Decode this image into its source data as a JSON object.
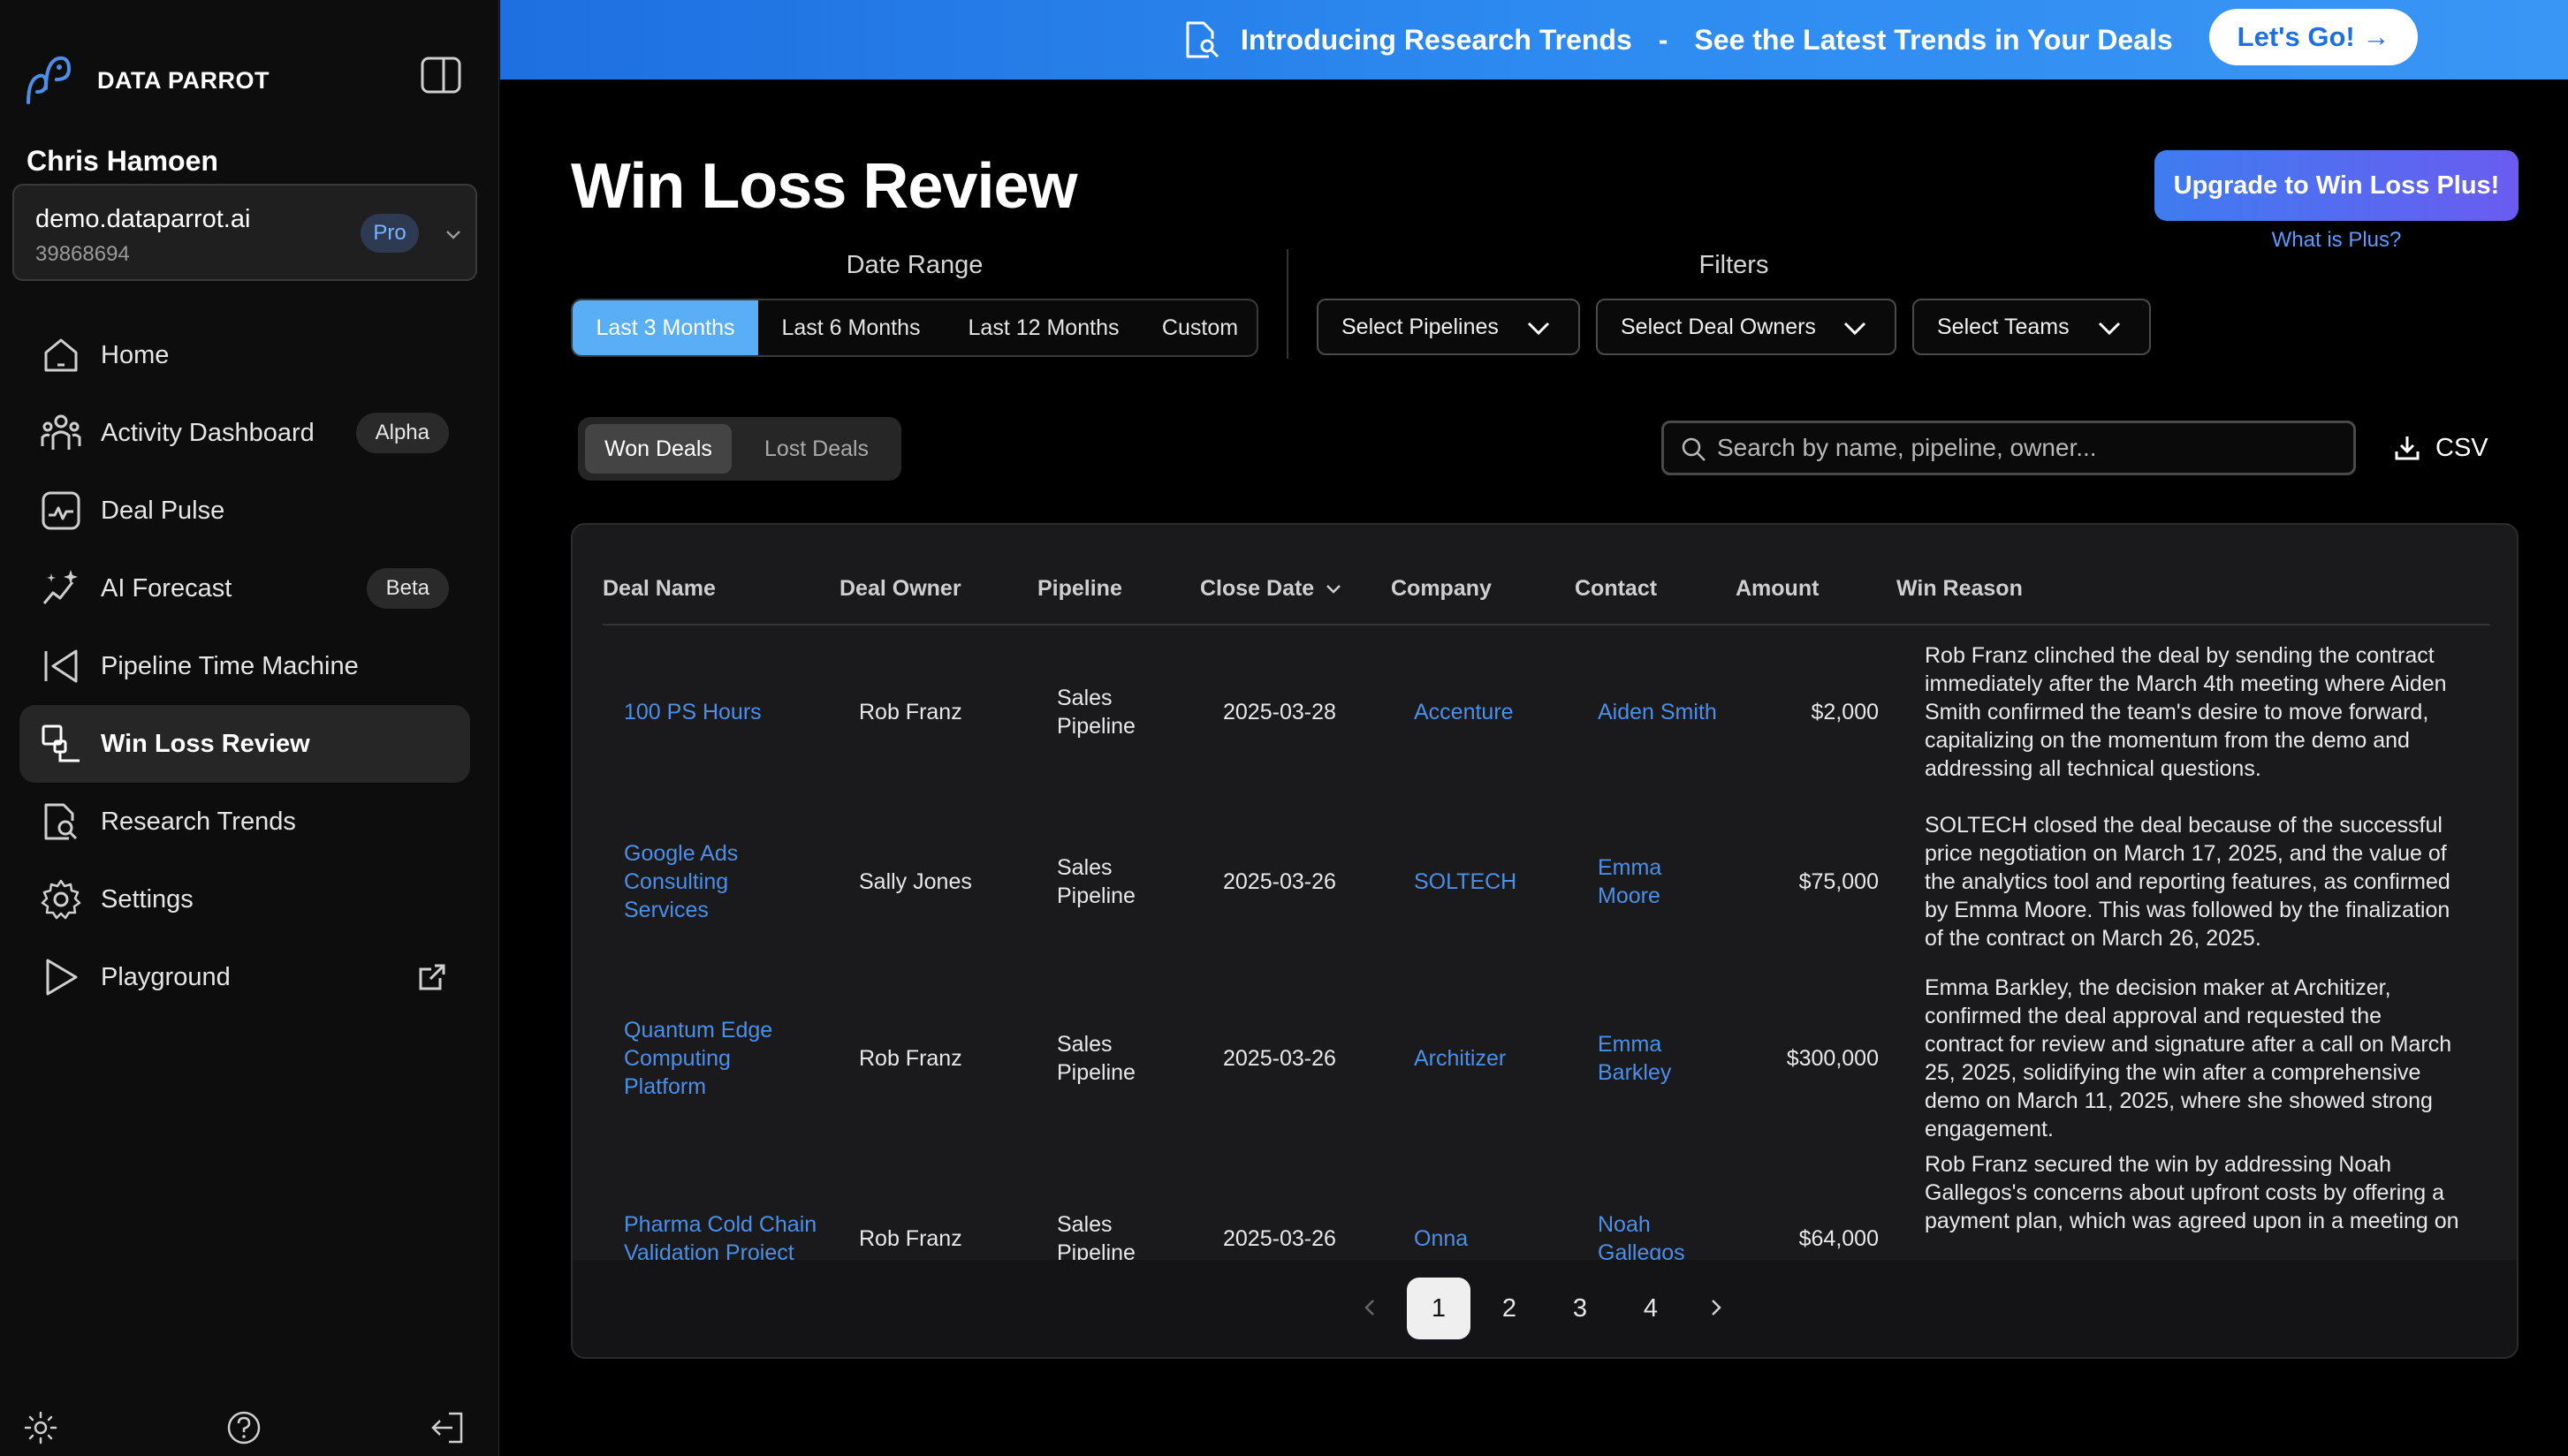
{
  "brand": {
    "name": "DATA PARROT"
  },
  "user": {
    "name": "Chris Hamoen"
  },
  "workspace": {
    "domain": "demo.dataparrot.ai",
    "id": "39868694",
    "plan": "Pro"
  },
  "nav": [
    {
      "label": "Home",
      "icon": "home-icon"
    },
    {
      "label": "Activity Dashboard",
      "icon": "people-icon",
      "badge": "Alpha"
    },
    {
      "label": "Deal Pulse",
      "icon": "pulse-icon"
    },
    {
      "label": "AI Forecast",
      "icon": "sparkle-icon",
      "badge": "Beta"
    },
    {
      "label": "Pipeline Time Machine",
      "icon": "rewind-icon"
    },
    {
      "label": "Win Loss Review",
      "icon": "win-loss-icon",
      "active": true
    },
    {
      "label": "Research Trends",
      "icon": "document-search-icon"
    },
    {
      "label": "Settings",
      "icon": "gear-icon"
    },
    {
      "label": "Playground",
      "icon": "play-icon"
    }
  ],
  "banner": {
    "title": "Introducing Research Trends",
    "separator": "-",
    "subtitle": "See the Latest Trends in Your Deals",
    "cta": "Let's Go! →"
  },
  "page": {
    "title": "Win Loss Review",
    "upgrade": "Upgrade to Win Loss Plus!",
    "what_plus": "What is Plus?"
  },
  "date_range": {
    "label": "Date Range",
    "options": [
      "Last 3 Months",
      "Last 6 Months",
      "Last 12 Months",
      "Custom"
    ],
    "selected": "Last 3 Months"
  },
  "filters": {
    "label": "Filters",
    "pipelines": "Select Pipelines",
    "owners": "Select Deal Owners",
    "teams": "Select Teams"
  },
  "deal_tabs": {
    "won": "Won Deals",
    "lost": "Lost Deals",
    "selected": "Won Deals"
  },
  "search": {
    "placeholder": "Search by name, pipeline, owner...",
    "value": ""
  },
  "csv_label": "CSV",
  "table": {
    "columns": [
      "Deal Name",
      "Deal Owner",
      "Pipeline",
      "Close Date",
      "Company",
      "Contact",
      "Amount",
      "Win Reason"
    ],
    "rows": [
      {
        "deal": [
          "100 PS Hours"
        ],
        "owner": "Rob Franz",
        "pipeline": [
          "Sales",
          "Pipeline"
        ],
        "date": "2025-03-28",
        "company": "Accenture",
        "contact": [
          "Aiden Smith"
        ],
        "amount": "$2,000",
        "reason": [
          "Rob Franz clinched the deal by sending the contract",
          "immediately after the March 4th meeting where Aiden",
          "Smith confirmed the team's desire to move forward,",
          "capitalizing on the momentum from the demo and",
          "addressing all technical questions."
        ]
      },
      {
        "deal": [
          "Google Ads",
          "Consulting",
          "Services"
        ],
        "owner": "Sally Jones",
        "pipeline": [
          "Sales",
          "Pipeline"
        ],
        "date": "2025-03-26",
        "company": "SOLTECH",
        "contact": [
          "Emma",
          "Moore"
        ],
        "amount": "$75,000",
        "reason": [
          "SOLTECH closed the deal because of the successful",
          "price negotiation on March 17, 2025, and the value of",
          "the analytics tool and reporting features, as confirmed",
          "by Emma Moore. This was followed by the finalization",
          "of the contract on March 26, 2025."
        ]
      },
      {
        "deal": [
          "Quantum Edge",
          "Computing",
          "Platform"
        ],
        "owner": "Rob Franz",
        "pipeline": [
          "Sales",
          "Pipeline"
        ],
        "date": "2025-03-26",
        "company": "Architizer",
        "contact": [
          "Emma",
          "Barkley"
        ],
        "amount": "$300,000",
        "reason": [
          "Emma Barkley, the decision maker at Architizer,",
          "confirmed the deal approval and requested the",
          "contract for review and signature after a call on March",
          "25, 2025, solidifying the win after a comprehensive",
          "demo on March 11, 2025, where she showed strong",
          "engagement."
        ]
      },
      {
        "deal": [
          "Pharma Cold Chain",
          "Validation Project"
        ],
        "owner": "Rob Franz",
        "pipeline": [
          "Sales",
          "Pipeline"
        ],
        "date": "2025-03-26",
        "company": "Onna",
        "contact": [
          "Noah",
          "Gallegos"
        ],
        "amount": "$64,000",
        "reason": [
          "Rob Franz secured the win by addressing Noah",
          "Gallegos's concerns about upfront costs by offering a",
          "payment plan, which was agreed upon in a meeting on"
        ]
      }
    ]
  },
  "pagination": {
    "pages": [
      "1",
      "2",
      "3",
      "4"
    ],
    "current": "1"
  },
  "colors": {
    "accent": "#4b8fe8",
    "segment_active": "#5aaef5",
    "banner": "#2d8af0"
  }
}
